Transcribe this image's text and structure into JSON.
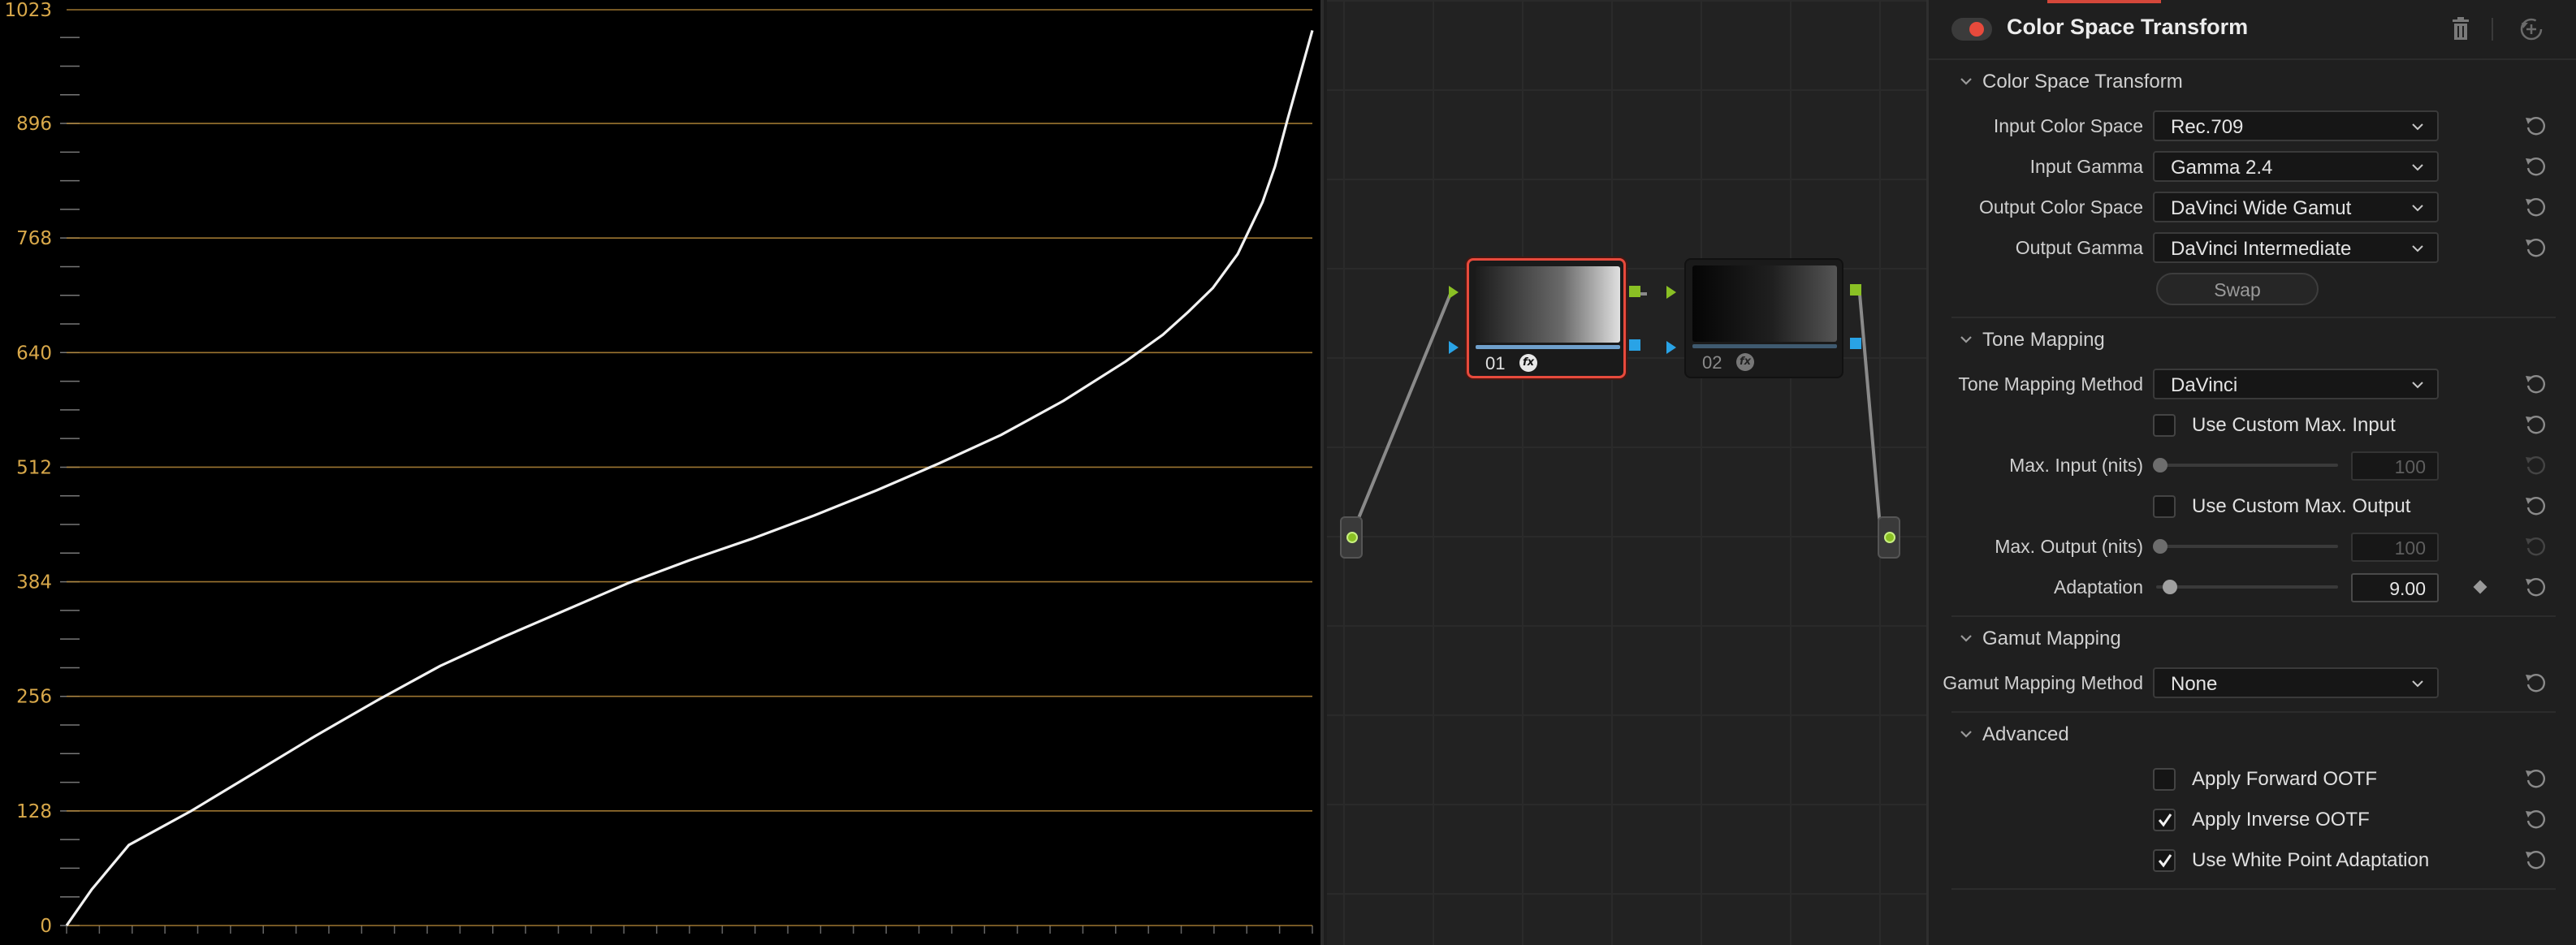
{
  "scope": {
    "y_ticks": [
      "0",
      "128",
      "256",
      "384",
      "512",
      "640",
      "768",
      "896",
      "1023"
    ],
    "colors": {
      "grid": "#b88a3a",
      "tick_text": "#d8a84a",
      "curve": "#f2f2f2"
    }
  },
  "chart_data": {
    "type": "line",
    "title": "",
    "xlabel": "",
    "ylabel": "",
    "ylim": [
      0,
      1023
    ],
    "xlim": [
      0,
      1
    ],
    "y_ticks": [
      0,
      128,
      256,
      384,
      512,
      640,
      768,
      896,
      1023
    ],
    "grid": true,
    "series": [
      {
        "x": [
          0.0,
          0.02,
          0.05,
          0.1,
          0.15,
          0.2,
          0.25,
          0.3,
          0.35,
          0.4,
          0.45,
          0.5,
          0.55,
          0.6,
          0.65,
          0.7,
          0.75,
          0.8,
          0.85,
          0.88,
          0.9,
          0.92,
          0.94,
          0.96,
          0.97,
          0.98,
          0.99,
          1.0
        ],
        "y": [
          0,
          40,
          90,
          128,
          170,
          212,
          252,
          290,
          322,
          352,
          382,
          408,
          432,
          458,
          486,
          516,
          548,
          586,
          630,
          660,
          685,
          712,
          750,
          808,
          848,
          900,
          950,
          1000
        ]
      }
    ]
  },
  "nodes": {
    "node1": {
      "label": "01",
      "fx": "fx"
    },
    "node2": {
      "label": "02",
      "fx": "fx"
    },
    "colors": {
      "selected_border": "#e84a3c",
      "link": "#8a8a8a",
      "rgb_port": "#8ac024",
      "alpha_port": "#29a3e6"
    }
  },
  "panel": {
    "title": "Color Space Transform",
    "sections": {
      "cst": "Color Space Transform",
      "tone": "Tone Mapping",
      "gamut": "Gamut Mapping",
      "advanced": "Advanced"
    },
    "cst": {
      "input_color_space": {
        "label": "Input Color Space",
        "value": "Rec.709"
      },
      "input_gamma": {
        "label": "Input Gamma",
        "value": "Gamma 2.4"
      },
      "output_color_space": {
        "label": "Output Color Space",
        "value": "DaVinci Wide Gamut"
      },
      "output_gamma": {
        "label": "Output Gamma",
        "value": "DaVinci Intermediate"
      },
      "swap": "Swap"
    },
    "tone": {
      "method": {
        "label": "Tone Mapping Method",
        "value": "DaVinci"
      },
      "custom_max_input": {
        "label": "Use Custom Max. Input",
        "checked": false
      },
      "max_input": {
        "label": "Max. Input (nits)",
        "value": "100"
      },
      "custom_max_output": {
        "label": "Use Custom Max. Output",
        "checked": false
      },
      "max_output": {
        "label": "Max. Output (nits)",
        "value": "100"
      },
      "adaptation": {
        "label": "Adaptation",
        "value": "9.00"
      }
    },
    "gamut": {
      "method": {
        "label": "Gamut Mapping Method",
        "value": "None"
      }
    },
    "advanced": {
      "forward_ootf": {
        "label": "Apply Forward OOTF",
        "checked": false
      },
      "inverse_ootf": {
        "label": "Apply Inverse OOTF",
        "checked": true
      },
      "white_point": {
        "label": "Use White Point Adaptation",
        "checked": true
      }
    },
    "colors": {
      "accent_red": "#e84a3c"
    }
  }
}
